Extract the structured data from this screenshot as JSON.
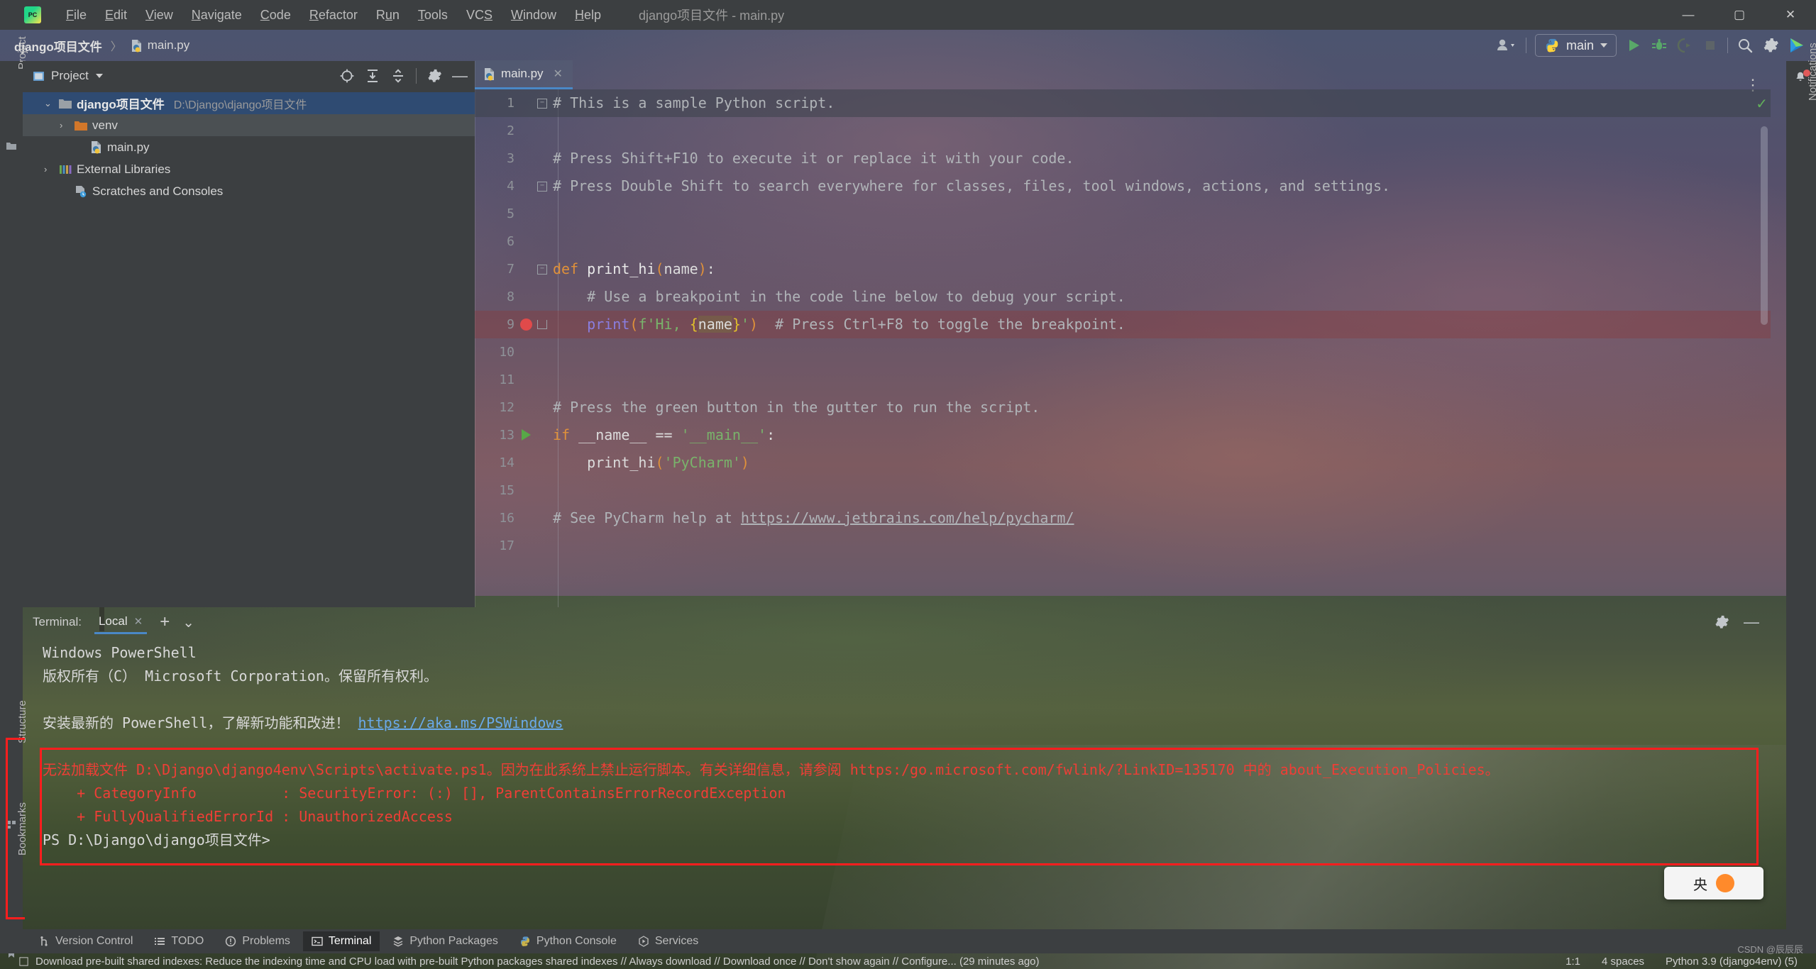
{
  "window": {
    "title": "django项目文件 - main.py",
    "logo_text": "PC",
    "controls": {
      "minimize": "—",
      "maximize": "▢",
      "close": "✕"
    }
  },
  "menu": [
    {
      "label": "File",
      "mnemonic": "F"
    },
    {
      "label": "Edit",
      "mnemonic": "E"
    },
    {
      "label": "View",
      "mnemonic": "V"
    },
    {
      "label": "Navigate",
      "mnemonic": "N"
    },
    {
      "label": "Code",
      "mnemonic": "C"
    },
    {
      "label": "Refactor",
      "mnemonic": "R"
    },
    {
      "label": "Run",
      "mnemonic": "u"
    },
    {
      "label": "Tools",
      "mnemonic": "T"
    },
    {
      "label": "VCS",
      "mnemonic": "S"
    },
    {
      "label": "Window",
      "mnemonic": "W"
    },
    {
      "label": "Help",
      "mnemonic": "H"
    }
  ],
  "navbar": {
    "breadcrumbs": [
      "django项目文件",
      "main.py"
    ],
    "separator": "〉",
    "run_config": "main",
    "icons": {
      "profile": "user-profile-icon",
      "run": "run-icon",
      "debug": "debug-icon",
      "coverage": "coverage-icon",
      "stop": "stop-icon",
      "search": "search-everywhere-icon",
      "settings": "settings-icon",
      "ai": "ai-assistant-icon"
    }
  },
  "project_panel": {
    "title": "Project",
    "tree": [
      {
        "label": "django项目文件",
        "path": "D:\\Django\\django项目文件",
        "twisty": "⌄",
        "icon": "folder-icon",
        "level": 0,
        "selected": true
      },
      {
        "label": "venv",
        "path": "",
        "twisty": "›",
        "icon": "folder-orange-icon",
        "level": 1,
        "selected": false
      },
      {
        "label": "main.py",
        "path": "",
        "twisty": "",
        "icon": "python-file-icon",
        "level": 2,
        "selected": false
      },
      {
        "label": "External Libraries",
        "path": "",
        "twisty": "›",
        "icon": "libraries-icon",
        "level": 0,
        "selected": false
      },
      {
        "label": "Scratches and Consoles",
        "path": "",
        "twisty": "",
        "icon": "scratches-icon",
        "level": 1,
        "selected": false
      }
    ]
  },
  "left_strip": {
    "labels": [
      "Project",
      "Structure",
      "Bookmarks"
    ]
  },
  "right_strip": {
    "label": "Notifications"
  },
  "editor": {
    "tab": "main.py",
    "tab_close": "✕",
    "lines": [
      {
        "n": "1",
        "text": "# This is a sample Python script."
      },
      {
        "n": "2",
        "text": ""
      },
      {
        "n": "3",
        "text": "# Press Shift+F10 to execute it or replace it with your code."
      },
      {
        "n": "4",
        "text": "# Press Double Shift to search everywhere for classes, files, tool windows, actions, and settings."
      },
      {
        "n": "5",
        "text": ""
      },
      {
        "n": "6",
        "text": ""
      },
      {
        "n": "7",
        "text": "def print_hi(name):"
      },
      {
        "n": "8",
        "text": "    # Use a breakpoint in the code line below to debug your script."
      },
      {
        "n": "9",
        "text": "    print(f'Hi, {name}')  # Press Ctrl+F8 to toggle the breakpoint."
      },
      {
        "n": "10",
        "text": ""
      },
      {
        "n": "11",
        "text": ""
      },
      {
        "n": "12",
        "text": "# Press the green button in the gutter to run the script."
      },
      {
        "n": "13",
        "text": "if __name__ == '__main__':"
      },
      {
        "n": "14",
        "text": "    print_hi('PyCharm')"
      },
      {
        "n": "15",
        "text": ""
      },
      {
        "n": "16",
        "text": "# See PyCharm help at https://www.jetbrains.com/help/pycharm/"
      },
      {
        "n": "17",
        "text": ""
      }
    ],
    "breakpoint_line": "9",
    "run_marker_line": "13",
    "inspection_status": "✓"
  },
  "terminal": {
    "label": "Terminal:",
    "tab": "Local",
    "tab_close": "✕",
    "add": "+",
    "chevron": "⌄",
    "lines": [
      {
        "text": "Windows PowerShell",
        "kind": "plain"
      },
      {
        "text": "版权所有（C） Microsoft Corporation。保留所有权利。",
        "kind": "plain"
      },
      {
        "text": "",
        "kind": "plain"
      },
      {
        "text": "安装最新的 PowerShell，了解新功能和改进！ https://aka.ms/PSWindows",
        "kind": "link-tail",
        "link": "https://aka.ms/PSWindows"
      },
      {
        "text": "",
        "kind": "plain"
      },
      {
        "text": "无法加载文件 D:\\Django\\django4env\\Scripts\\activate.ps1。因为在此系统上禁止运行脚本。有关详细信息，请参阅 https:/go.microsoft.com/fwlink/?LinkID=135170 中的 about_Execution_Policies。",
        "kind": "error"
      },
      {
        "text": "    + CategoryInfo          : SecurityError: (:) [], ParentContainsErrorRecordException",
        "kind": "error"
      },
      {
        "text": "    + FullyQualifiedErrorId : UnauthorizedAccess",
        "kind": "error"
      },
      {
        "text": "PS D:\\Django\\django项目文件>",
        "kind": "plain"
      }
    ]
  },
  "ime_popup": {
    "text": "央"
  },
  "bottom_bar": [
    {
      "label": "Version Control",
      "icon": "branch-icon",
      "active": false
    },
    {
      "label": "TODO",
      "icon": "todo-icon",
      "active": false
    },
    {
      "label": "Problems",
      "icon": "problems-icon",
      "active": false
    },
    {
      "label": "Terminal",
      "icon": "terminal-icon",
      "active": true
    },
    {
      "label": "Python Packages",
      "icon": "packages-icon",
      "active": false
    },
    {
      "label": "Python Console",
      "icon": "python-console-icon",
      "active": false
    },
    {
      "label": "Services",
      "icon": "services-icon",
      "active": false
    }
  ],
  "status_bar": {
    "message": "Download pre-built shared indexes: Reduce the indexing time and CPU load with pre-built Python packages shared indexes // Always download // Download once // Don't show again // Configure... (29 minutes ago)",
    "caret": "1:1",
    "indent": "4 spaces",
    "interpreter": "Python 3.9 (django4env) (5)"
  },
  "watermark": "CSDN @辰辰辰",
  "colors": {
    "chrome": "#3c3f41",
    "accent_blue": "#4a88c7",
    "selection": "#2f4b72",
    "error_red": "#ef3e36",
    "box_red": "#ff1e1e",
    "green_run": "#58a847",
    "breakpoint": "#e04a4a"
  }
}
